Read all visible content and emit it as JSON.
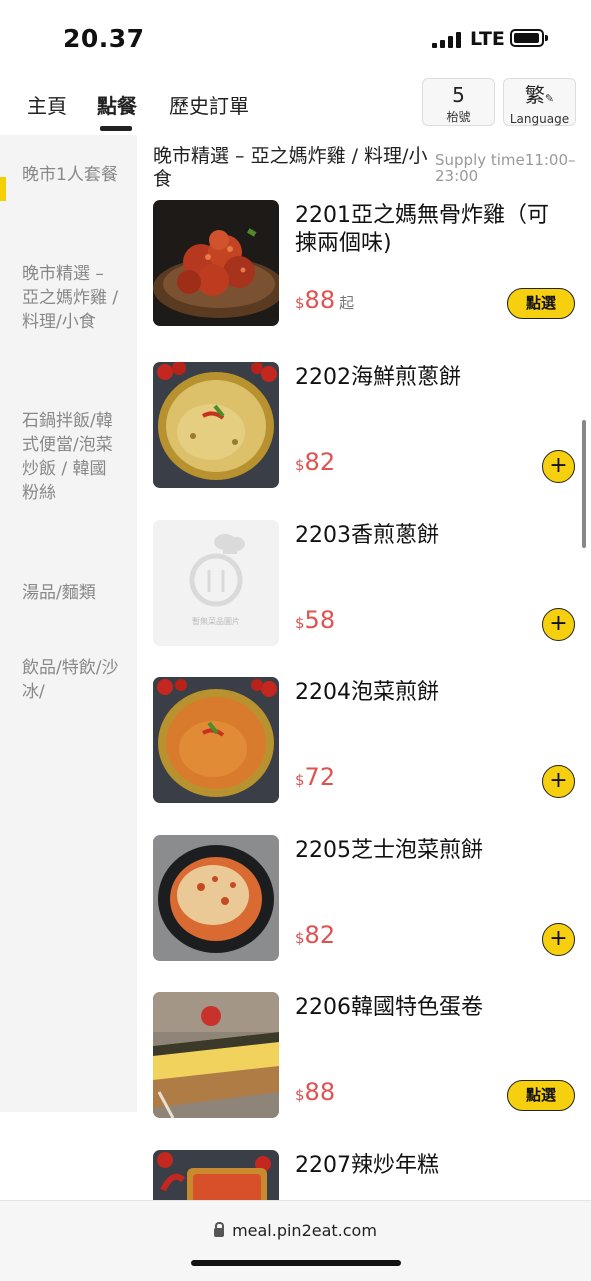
{
  "status_bar": {
    "time": "20.37",
    "network": "LTE"
  },
  "nav": {
    "tabs": [
      "主頁",
      "點餐",
      "歷史訂單"
    ],
    "active_tab": 1,
    "table_number": "5",
    "table_label": "枱號",
    "language_main": "繁",
    "language_label": "Language"
  },
  "sidebar": {
    "categories": [
      "晚市1人套餐",
      "晚市精選 – 亞之媽炸雞 / 料理/小食",
      "石鍋拌飯/韓式便當/泡菜炒飯 / 韓國粉絲",
      "湯品/麵類",
      "飲品/特飲/沙冰/"
    ],
    "active_index": 0
  },
  "section": {
    "title": "晚市精選 – 亞之媽炸雞 / 料理/小食",
    "supply_time": "Supply time11:00–23:00"
  },
  "placeholder_text": "暫無菜品圖片",
  "items": [
    {
      "name": "2201亞之媽無骨炸雞（可揀兩個味)",
      "currency": "$",
      "price": "88",
      "suffix": "起",
      "action": "點選"
    },
    {
      "name": "2202海鮮煎蔥餅",
      "currency": "$",
      "price": "82",
      "action": "+"
    },
    {
      "name": "2203香煎蔥餅",
      "currency": "$",
      "price": "58",
      "action": "+"
    },
    {
      "name": "2204泡菜煎餅",
      "currency": "$",
      "price": "72",
      "action": "+"
    },
    {
      "name": "2205芝士泡菜煎餅",
      "currency": "$",
      "price": "82",
      "action": "+"
    },
    {
      "name": "2206韓國特色蛋卷",
      "currency": "$",
      "price": "88",
      "action": "點選"
    },
    {
      "name": "2207辣炒年糕"
    }
  ],
  "url": "meal.pin2eat.com",
  "colors": {
    "accent": "#f6cf0e",
    "price": "#e05252",
    "sidebar_bg": "#f4f4f4"
  }
}
